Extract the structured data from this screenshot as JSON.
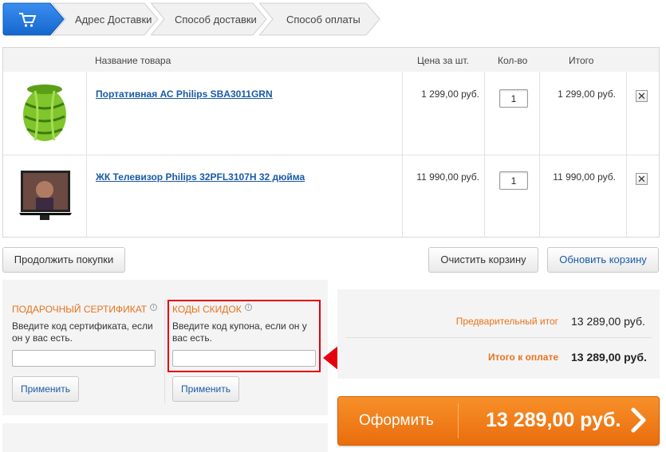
{
  "steps": [
    {
      "label": "Адрес Доставки"
    },
    {
      "label": "Способ доставки"
    },
    {
      "label": "Способ оплаты"
    }
  ],
  "table": {
    "headers": {
      "name": "Название товара",
      "price": "Цена за шт.",
      "qty": "Кол-во",
      "total": "Итого"
    },
    "rows": [
      {
        "name": "Портативная АС Philips SBA3011GRN",
        "price": "1 299,00 руб.",
        "qty": "1",
        "total": "1 299,00 руб."
      },
      {
        "name": "ЖК Телевизор Philips 32PFL3107H 32 дюйма",
        "price": "11 990,00 руб.",
        "qty": "1",
        "total": "11 990,00 руб."
      }
    ]
  },
  "buttons": {
    "continue": "Продолжить покупки",
    "clear": "Очистить корзину",
    "update": "Обновить корзину",
    "apply": "Применить"
  },
  "certificate": {
    "title": "ПОДАРОЧНЫЙ СЕРТИФИКАТ",
    "desc": "Введите код сертификата, если он у вас есть."
  },
  "coupon": {
    "title": "КОДЫ СКИДОК",
    "desc": "Введите код купона, если он у вас есть."
  },
  "summary": {
    "subtotal_label": "Предварительный итог",
    "subtotal_value": "13 289,00 руб.",
    "total_label": "Итого к оплате",
    "total_value": "13 289,00 руб."
  },
  "checkout": {
    "label": "Оформить",
    "total": "13 289,00 руб."
  },
  "icons": {
    "cart": "cart-icon",
    "info": "info-icon",
    "remove": "close-icon",
    "arrow": "red-arrow-icon",
    "chevron": "chevron-right-icon"
  },
  "colors": {
    "accent_blue": "#1a73d9",
    "orange": "#ef7a16",
    "link": "#1a5aa6",
    "highlight_red": "#e4000f"
  }
}
